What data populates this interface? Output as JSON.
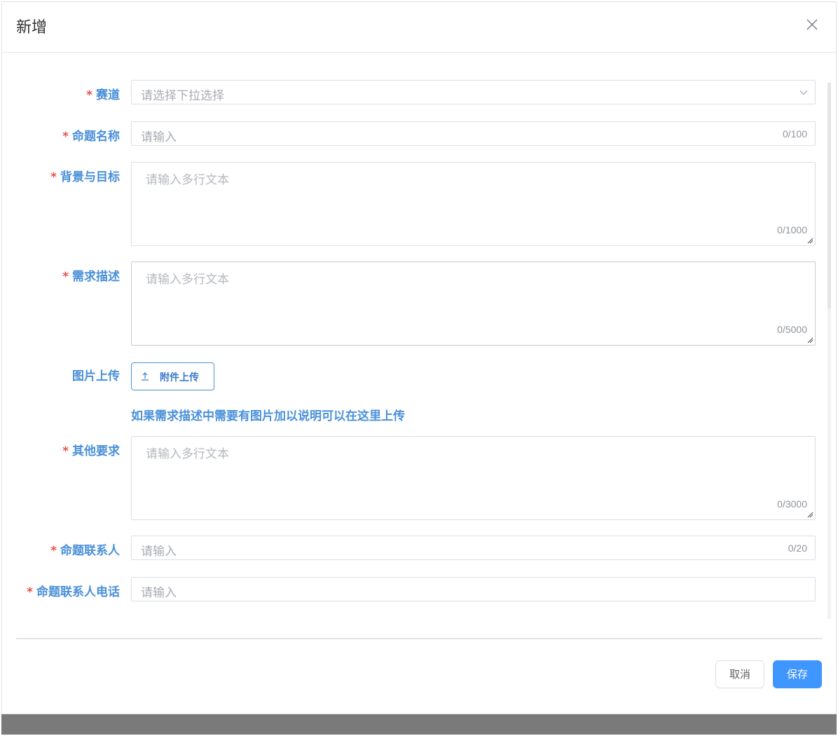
{
  "dialog": {
    "title": "新增"
  },
  "form": {
    "track": {
      "label": "赛道",
      "placeholder": "请选择下拉选择"
    },
    "topic_name": {
      "label": "命题名称",
      "placeholder": "请输入",
      "counter": "0/100"
    },
    "background": {
      "label": "背景与目标",
      "placeholder": "请输入多行文本",
      "counter": "0/1000"
    },
    "requirement": {
      "label": "需求描述",
      "placeholder": "请输入多行文本",
      "counter": "0/5000"
    },
    "image_upload": {
      "label": "图片上传",
      "button_label": "附件上传",
      "hint": "如果需求描述中需要有图片加以说明可以在这里上传"
    },
    "other": {
      "label": "其他要求",
      "placeholder": "请输入多行文本",
      "counter": "0/3000"
    },
    "contact": {
      "label": "命题联系人",
      "placeholder": "请输入",
      "counter": "0/20"
    },
    "contact_phone": {
      "label": "命题联系人电话",
      "placeholder": "请输入"
    },
    "required_mark": "*"
  },
  "footer": {
    "cancel_label": "取消",
    "save_label": "保存"
  },
  "colors": {
    "label": "#4a90d9",
    "required": "#e5534b",
    "primary": "#4096ff"
  }
}
